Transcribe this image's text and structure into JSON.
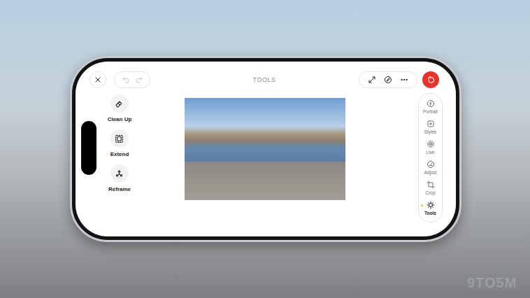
{
  "title": "TOOLS",
  "toolbar": {
    "undo_disabled": true,
    "redo_disabled": true
  },
  "tools": [
    {
      "label": "Clean Up"
    },
    {
      "label": "Extend"
    },
    {
      "label": "Reframe"
    }
  ],
  "sidebar": {
    "items": [
      {
        "label": "Portrait",
        "selected": false
      },
      {
        "label": "Styles",
        "selected": false
      },
      {
        "label": "Live",
        "selected": false
      },
      {
        "label": "Adjust",
        "selected": false
      },
      {
        "label": "Crop",
        "selected": false
      },
      {
        "label": "Tools",
        "selected": true
      }
    ]
  },
  "watermark": "9TO5M"
}
